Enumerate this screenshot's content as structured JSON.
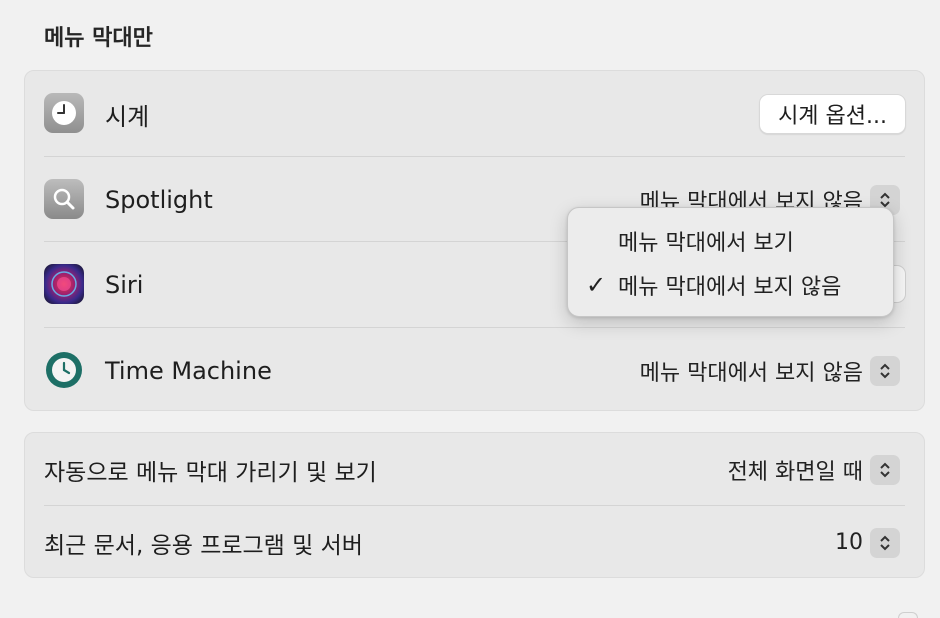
{
  "section_title": "메뉴 막대만",
  "rows": {
    "clock": {
      "label": "시계",
      "button": "시계 옵션...",
      "icon": "clock-icon"
    },
    "spotlight": {
      "label": "Spotlight",
      "value": "메뉴 막대에서 보지 않음",
      "icon": "spotlight-magnifier-icon"
    },
    "siri": {
      "label": "Siri",
      "icon": "siri-orb-icon"
    },
    "time_machine": {
      "label": "Time Machine",
      "value": "메뉴 막대에서 보지 않음",
      "icon": "time-machine-icon"
    }
  },
  "popup": {
    "options": [
      {
        "label": "메뉴 막대에서 보기",
        "checked": false
      },
      {
        "label": "메뉴 막대에서 보지 않음",
        "checked": true
      }
    ],
    "check_glyph": "✓"
  },
  "settings2": {
    "autohide": {
      "label": "자동으로 메뉴 막대 가리기 및 보기",
      "value": "전체 화면일 때"
    },
    "recent": {
      "label": "최근 문서, 응용 프로그램 및 서버",
      "value": "10"
    }
  },
  "colors": {
    "background": "#f1f1f1",
    "card": "#e8e8e8",
    "stepper": "#d4d4d4"
  }
}
